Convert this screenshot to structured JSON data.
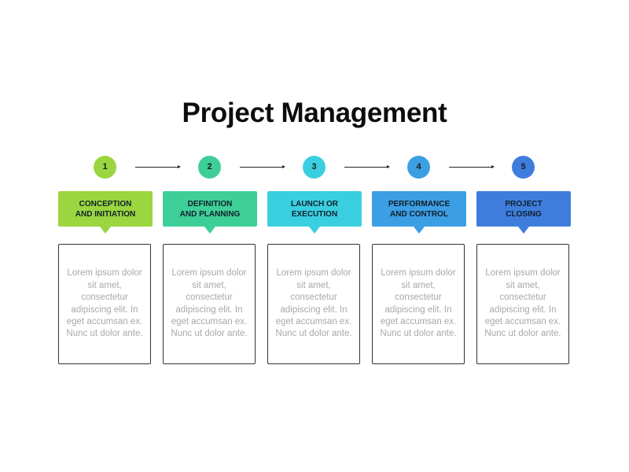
{
  "title": "Project Management",
  "stages": [
    {
      "number": "1",
      "label_line1": "CONCEPTION",
      "label_line2": "AND INITIATION",
      "color": "#9BD53F",
      "description": "Lorem ipsum dolor sit amet, consectetur adipiscing elit. In eget accumsan ex. Nunc ut dolor ante."
    },
    {
      "number": "2",
      "label_line1": "DEFINITION",
      "label_line2": "AND PLANNING",
      "color": "#3ECF98",
      "description": "Lorem ipsum dolor sit amet, consectetur adipiscing elit. In eget accumsan ex. Nunc ut dolor ante."
    },
    {
      "number": "3",
      "label_line1": "LAUNCH OR",
      "label_line2": "EXECUTION",
      "color": "#3ACFE0",
      "description": "Lorem ipsum dolor sit amet, consectetur adipiscing elit. In eget accumsan ex. Nunc ut dolor ante."
    },
    {
      "number": "4",
      "label_line1": "PERFORMANCE",
      "label_line2": "AND CONTROL",
      "color": "#3C9EE3",
      "description": "Lorem ipsum dolor sit amet, consectetur adipiscing elit. In eget accumsan ex. Nunc ut dolor ante."
    },
    {
      "number": "5",
      "label_line1": "PROJECT",
      "label_line2": "CLOSING",
      "color": "#3F7DDD",
      "description": "Lorem ipsum dolor sit amet, consectetur adipiscing elit. In eget accumsan ex. Nunc ut dolor ante."
    }
  ]
}
